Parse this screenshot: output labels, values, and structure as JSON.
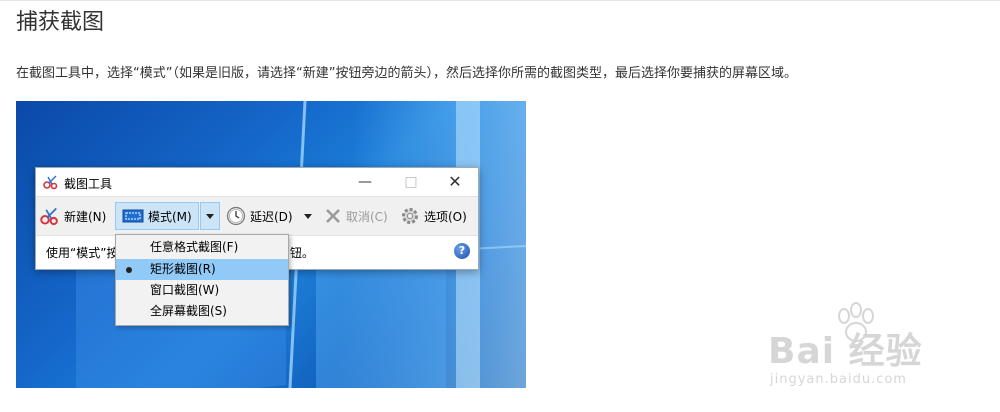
{
  "article": {
    "title": "捕获截图",
    "intro": "在截图工具中，选择“模式”（如果是旧版，请选择“新建”按钮旁边的箭头），然后选择你所需的截图类型，最后选择你要捕获的屏幕区域。"
  },
  "snipping_tool": {
    "title": "截图工具",
    "window_controls": {
      "minimize": "—",
      "maximize": "□",
      "close": "✕"
    },
    "toolbar": {
      "new_label": "新建(N)",
      "mode_label": "模式(M)",
      "delay_label": "延迟(D)",
      "cancel_label": "取消(C)",
      "options_label": "选项(O)"
    },
    "status_text_visible_start": "使用“模式”按",
    "status_text_visible_end": "钮。",
    "help_glyph": "?",
    "mode_menu": {
      "items": [
        {
          "label": "任意格式截图(F)"
        },
        {
          "label": "矩形截图(R)",
          "selected": true
        },
        {
          "label": "窗口截图(W)"
        },
        {
          "label": "全屏幕截图(S)"
        }
      ]
    }
  },
  "watermark": {
    "brand": "Bai 经验",
    "url": "jingyan.baidu.com"
  },
  "colors": {
    "menu_selected": "#91c9f7",
    "mode_button_bg": "#cce4f7",
    "desktop_blue": "#1467c9"
  },
  "icons": [
    "scissors-icon",
    "rectangle-snip-icon",
    "chevron-down-icon",
    "clock-icon",
    "cancel-x-icon",
    "gear-icon",
    "help-icon",
    "minimize-icon",
    "maximize-icon",
    "close-icon",
    "paw-icon"
  ]
}
